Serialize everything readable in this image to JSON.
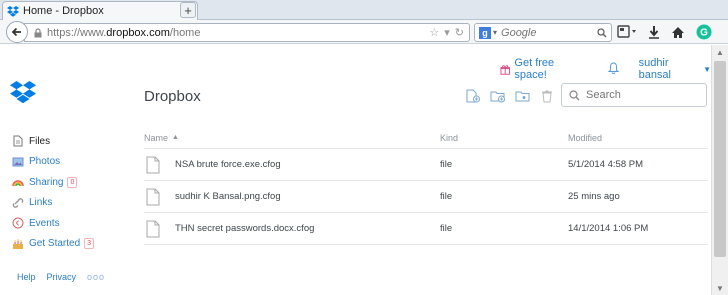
{
  "browser": {
    "tab_title": "Home - Dropbox",
    "url_prefix": "https://www.",
    "url_domain": "dropbox.com",
    "url_path": "/home",
    "search_engine": "Google",
    "search_placeholder": "Google"
  },
  "header": {
    "get_space": "Get free space!",
    "user_name": "sudhir bansal",
    "page_title": "Dropbox",
    "search_placeholder": "Search"
  },
  "sidebar": {
    "items": [
      {
        "label": "Files",
        "icon": "files-icon",
        "active": true
      },
      {
        "label": "Photos",
        "icon": "photos-icon"
      },
      {
        "label": "Sharing",
        "icon": "sharing-icon",
        "count": "0"
      },
      {
        "label": "Links",
        "icon": "links-icon"
      },
      {
        "label": "Events",
        "icon": "events-icon"
      },
      {
        "label": "Get Started",
        "icon": "get-started-icon",
        "count": "3"
      }
    ]
  },
  "footer": {
    "help": "Help",
    "privacy": "Privacy",
    "more": "ooo"
  },
  "table": {
    "headers": {
      "name": "Name",
      "kind": "Kind",
      "modified": "Modified"
    },
    "rows": [
      {
        "name": "NSA brute force.exe.cfog",
        "kind": "file",
        "modified": "5/1/2014 4:58 PM"
      },
      {
        "name": "sudhir K Bansal.png.cfog",
        "kind": "file",
        "modified": "25 mins ago"
      },
      {
        "name": "THN secret passwords.docx.cfog",
        "kind": "file",
        "modified": "14/1/2014 1:06 PM"
      }
    ]
  },
  "colors": {
    "accent": "#2a7ec4",
    "logo": "#007ee5",
    "badge": "#e44455"
  }
}
